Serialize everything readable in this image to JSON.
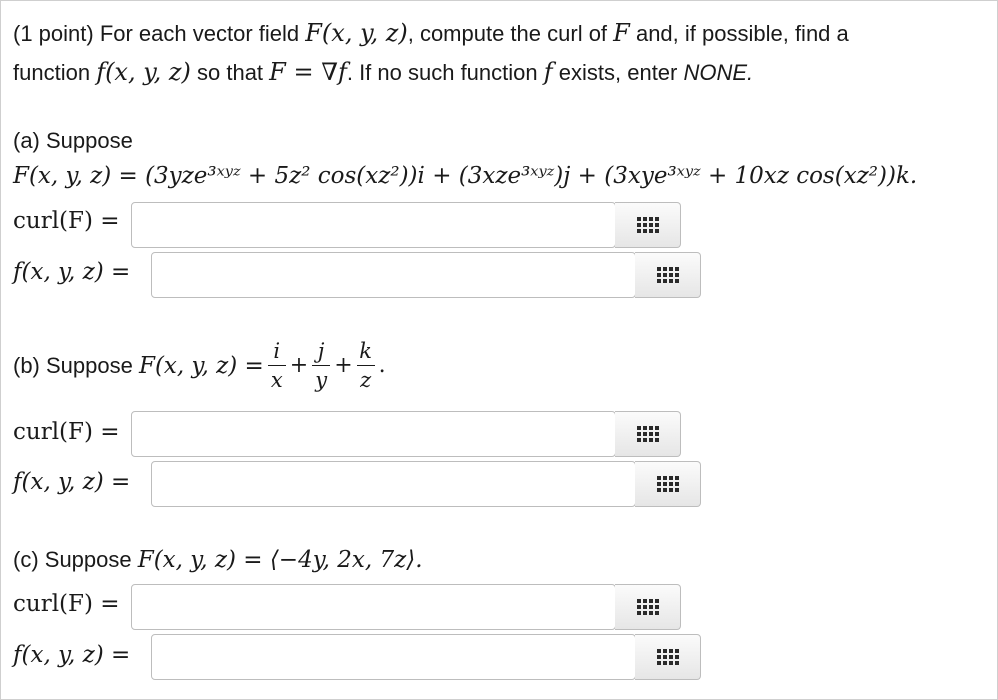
{
  "intro": {
    "line1_a": "(1 point) For each vector field",
    "line1_b": "F(x, y, z)",
    "line1_c": ", compute the curl of",
    "line1_d": "F",
    "line1_e": "and, if possible, find a",
    "line2_a": "function",
    "line2_b": "f(x, y, z)",
    "line2_c": "so that",
    "line2_d": "F = ∇f",
    "line2_e": ". If no such function",
    "line2_f": "f",
    "line2_g": "exists, enter",
    "line2_h": "NONE."
  },
  "part_a": {
    "heading": "(a) Suppose",
    "formula": "F(x, y, z) = (3yze³ˣʸᶻ + 5z² cos(xz²))i + (3xze³ˣʸᶻ)j + (3xye³ˣʸᶻ + 10xz cos(xz²))k.",
    "curl_label": "curl(F) =",
    "f_label": "f(x, y, z) =",
    "curl_value": "",
    "f_value": ""
  },
  "part_b": {
    "heading": "(b) Suppose",
    "lhs": "F(x, y, z) =",
    "num1": "i",
    "den1": "x",
    "num2": "j",
    "den2": "y",
    "num3": "k",
    "den3": "z",
    "plus": "+",
    "period": ".",
    "curl_label": "curl(F) =",
    "f_label": "f(x, y, z) =",
    "curl_value": "",
    "f_value": ""
  },
  "part_c": {
    "heading": "(c) Suppose",
    "formula": "F(x, y, z) = ⟨−4y, 2x, 7z⟩.",
    "curl_label": "curl(F) =",
    "f_label": "f(x, y, z) =",
    "curl_value": "",
    "f_value": ""
  },
  "icons": {
    "palette": "grid-palette-icon"
  }
}
